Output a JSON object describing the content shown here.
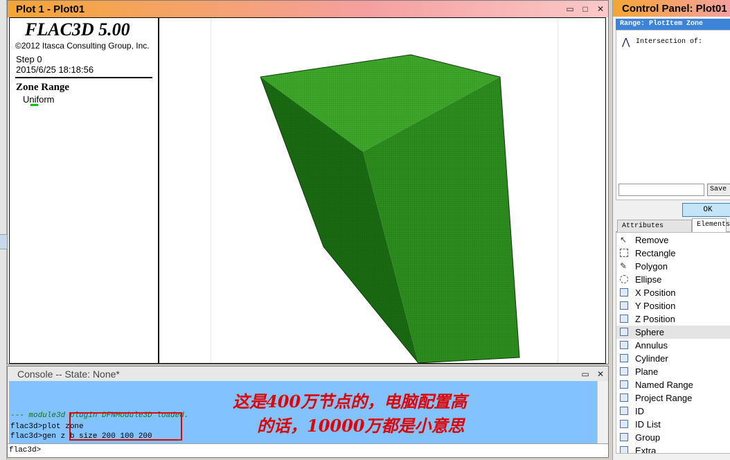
{
  "plot_window": {
    "title": "Plot 1 - Plot01",
    "controls": [
      "▭",
      "□",
      "✕"
    ]
  },
  "legend": {
    "app_title": "FLAC3D 5.00",
    "copyright": "©2012 Itasca Consulting Group, Inc.",
    "step": "Step 0",
    "datetime": "2015/6/25 18:18:56",
    "section_title": "Zone Range",
    "entry": "Uniform",
    "swatch_color": "#00c800"
  },
  "model": {
    "colors": {
      "front": "#2c8c1e",
      "side": "#1a6a12",
      "top": "#3ea82a",
      "outline": "#0f3a0a"
    }
  },
  "console": {
    "title": "Console -- State: None*",
    "controls": [
      "▭",
      "✕"
    ],
    "lines": [
      "--- module3d plugin DFNModule3D loaded.",
      "flac3d>plot zone",
      "flac3d>gen z b size 200 100 200"
    ],
    "annotation_line1": "这是400万节点的，电脑配置高",
    "annotation_line2": "的话，10000万都是小意思",
    "annotation_color": "#e00000",
    "prompt": "flac3d>"
  },
  "control_panel": {
    "title": "Control Panel: Plot01",
    "range_header": "Range: PlotItem Zone",
    "tree_item": "Intersection of:",
    "save_button": "Save I",
    "ok_button": "OK",
    "tabs": [
      "Attributes",
      "Elements"
    ],
    "elements": [
      {
        "label": "Remove",
        "icon": "remove-icon",
        "glyph": "↖"
      },
      {
        "label": "Rectangle",
        "icon": "rectangle-icon",
        "glyph": ""
      },
      {
        "label": "Polygon",
        "icon": "polygon-icon",
        "glyph": "✎"
      },
      {
        "label": "Ellipse",
        "icon": "ellipse-icon",
        "glyph": ""
      },
      {
        "label": "X Position",
        "icon": "x-position-icon",
        "glyph": ""
      },
      {
        "label": "Y Position",
        "icon": "y-position-icon",
        "glyph": ""
      },
      {
        "label": "Z Position",
        "icon": "z-position-icon",
        "glyph": ""
      },
      {
        "label": "Sphere",
        "icon": "sphere-icon",
        "glyph": "",
        "selected": true
      },
      {
        "label": "Annulus",
        "icon": "annulus-icon",
        "glyph": ""
      },
      {
        "label": "Cylinder",
        "icon": "cylinder-icon",
        "glyph": ""
      },
      {
        "label": "Plane",
        "icon": "plane-icon",
        "glyph": ""
      },
      {
        "label": "Named Range",
        "icon": "named-range-icon",
        "glyph": ""
      },
      {
        "label": "Project Range",
        "icon": "project-range-icon",
        "glyph": ""
      },
      {
        "label": "ID",
        "icon": "id-icon",
        "glyph": ""
      },
      {
        "label": "ID List",
        "icon": "id-list-icon",
        "glyph": ""
      },
      {
        "label": "Group",
        "icon": "group-icon",
        "glyph": ""
      },
      {
        "label": "Extra",
        "icon": "extra-icon",
        "glyph": ""
      }
    ]
  }
}
